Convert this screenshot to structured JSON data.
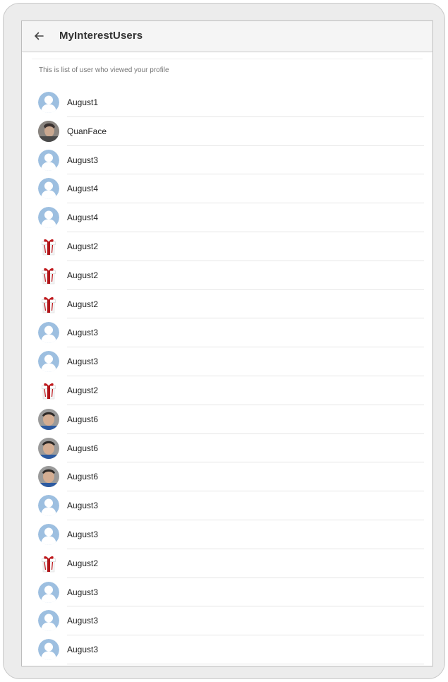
{
  "appbar": {
    "title": "MyInterestUsers",
    "back_icon": "arrow-left-icon"
  },
  "subtitle": "This is list of user who viewed your profile",
  "users": [
    {
      "name": "August1",
      "avatar": "default-avatar-icon"
    },
    {
      "name": "QuanFace",
      "avatar": "photo-avatar"
    },
    {
      "name": "August3",
      "avatar": "default-avatar-icon"
    },
    {
      "name": "August4",
      "avatar": "default-avatar-icon"
    },
    {
      "name": "August4",
      "avatar": "default-avatar-icon"
    },
    {
      "name": "August2",
      "avatar": "gift-icon"
    },
    {
      "name": "August2",
      "avatar": "gift-icon"
    },
    {
      "name": "August2",
      "avatar": "gift-icon"
    },
    {
      "name": "August3",
      "avatar": "default-avatar-icon"
    },
    {
      "name": "August3",
      "avatar": "default-avatar-icon"
    },
    {
      "name": "August2",
      "avatar": "gift-icon"
    },
    {
      "name": "August6",
      "avatar": "boy-photo-avatar"
    },
    {
      "name": "August6",
      "avatar": "boy-photo-avatar"
    },
    {
      "name": "August6",
      "avatar": "boy-photo-avatar"
    },
    {
      "name": "August3",
      "avatar": "default-avatar-icon"
    },
    {
      "name": "August3",
      "avatar": "default-avatar-icon"
    },
    {
      "name": "August2",
      "avatar": "gift-icon"
    },
    {
      "name": "August3",
      "avatar": "default-avatar-icon"
    },
    {
      "name": "August3",
      "avatar": "default-avatar-icon"
    },
    {
      "name": "August3",
      "avatar": "default-avatar-icon"
    }
  ],
  "colors": {
    "default_avatar_bg": "#9dbfe0",
    "gift_red": "#b0161a"
  }
}
